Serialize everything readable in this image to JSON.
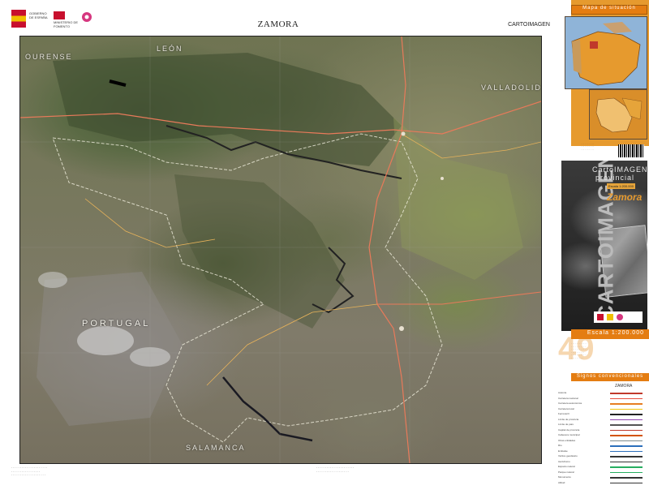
{
  "header": {
    "title": "ZAMORA",
    "series": "CARTOIMAGEN",
    "logo_text": "GOBIERNO DE ESPAÑA",
    "logo_ministry": "MINISTERIO DE FOMENTO"
  },
  "map": {
    "places": [
      {
        "label": "OURENSE",
        "size": "normal"
      },
      {
        "label": "LEÓN",
        "size": "normal"
      },
      {
        "label": "VALLADOLID",
        "size": "normal"
      },
      {
        "label": "PORTUGAL",
        "size": "large"
      },
      {
        "label": "SALAMANCA",
        "size": "normal"
      }
    ]
  },
  "side_panel": {
    "locator_title": "Mapa de situación",
    "cover_line1": "CartoIMAGEN",
    "cover_line2": "provincial",
    "cover_scale_tag": "Escala 1:200.000",
    "cover_name": "Zamora",
    "cover_vertical": "CARTOIMAGEN",
    "scale_label": "Escala 1:200.000",
    "sheet_number": "49",
    "legend_header": "Signos convencionales",
    "legend_title": "ZAMORA",
    "legend_rows": [
      {
        "label": "Autovía",
        "color": "#c0392b"
      },
      {
        "label": "Carretera nacional",
        "color": "#e74c3c"
      },
      {
        "label": "Carretera autonómica",
        "color": "#e67e22"
      },
      {
        "label": "Carretera local",
        "color": "#f1c40f"
      },
      {
        "label": "Ferrocarril",
        "color": "#222222"
      },
      {
        "label": "Límite de provincia",
        "color": "#8e44ad"
      },
      {
        "label": "Límite de país",
        "color": "#555555"
      },
      {
        "label": "Capital de provincia",
        "color": "#c0392b"
      },
      {
        "label": "Cabecera municipal",
        "color": "#d35400"
      },
      {
        "label": "Otras entidades",
        "color": "#7f8c8d"
      },
      {
        "label": "Río",
        "color": "#2c6fbb"
      },
      {
        "label": "Embalse",
        "color": "#2c6fbb"
      },
      {
        "label": "Vértice geodésico",
        "color": "#333333"
      },
      {
        "label": "Aeródromo",
        "color": "#333333"
      },
      {
        "label": "Espacio natural",
        "color": "#27ae60"
      },
      {
        "label": "Parque natural",
        "color": "#27ae60"
      },
      {
        "label": "Monumento",
        "color": "#333333"
      },
      {
        "label": "Altitud",
        "color": "#333333"
      }
    ]
  },
  "colors": {
    "accent_orange": "#e47d12",
    "panel_orange": "#e69a2e",
    "cover_dark": "#2a2a2a"
  }
}
